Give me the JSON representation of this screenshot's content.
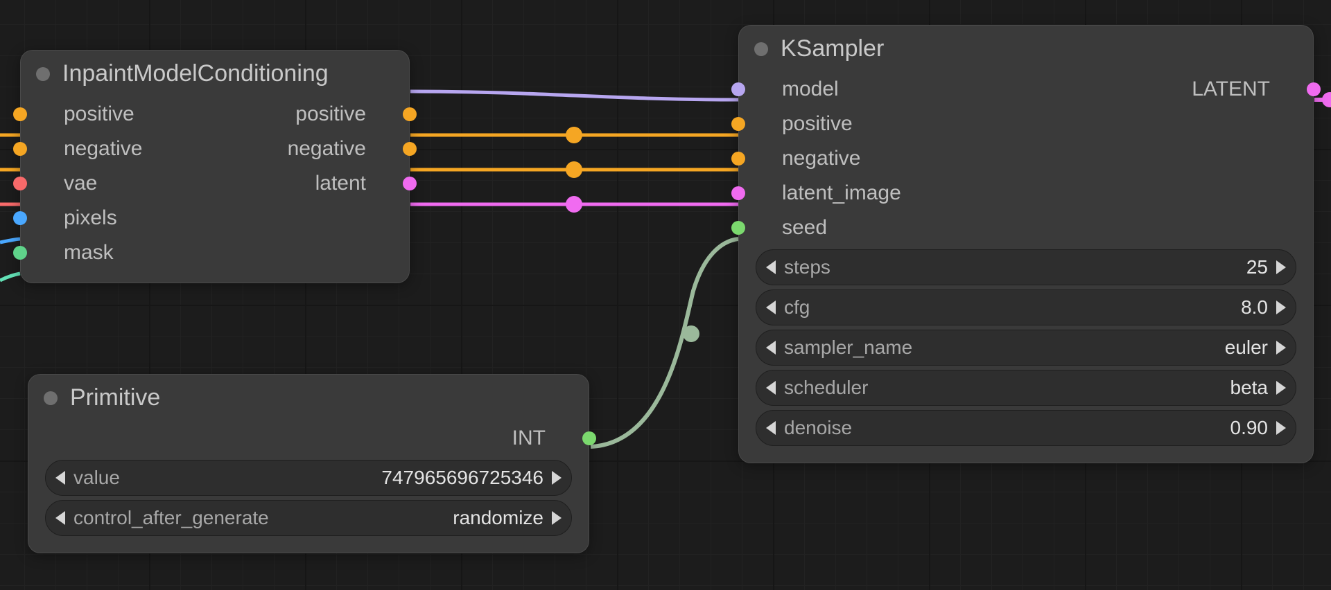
{
  "colors": {
    "orange": "#f5a623",
    "pinkred": "#f86a6a",
    "blue": "#4aa8ff",
    "green": "#5fd38a",
    "magenta": "#f06bf0",
    "lavender": "#b7a6f0",
    "lime": "#7bd96e",
    "teal": "#63e2b7"
  },
  "nodes": {
    "inpaint": {
      "title": "InpaintModelConditioning",
      "inputs": {
        "positive": "positive",
        "negative": "negative",
        "vae": "vae",
        "pixels": "pixels",
        "mask": "mask"
      },
      "outputs": {
        "positive": "positive",
        "negative": "negative",
        "latent": "latent"
      }
    },
    "primitive": {
      "title": "Primitive",
      "outputs": {
        "int": "INT"
      },
      "widgets": {
        "value": {
          "label": "value",
          "value": "747965696725346"
        },
        "control_after_generate": {
          "label": "control_after_generate",
          "value": "randomize"
        }
      }
    },
    "ksampler": {
      "title": "KSampler",
      "inputs": {
        "model": "model",
        "positive": "positive",
        "negative": "negative",
        "latent_image": "latent_image",
        "seed": "seed"
      },
      "outputs": {
        "latent": "LATENT"
      },
      "widgets": {
        "steps": {
          "label": "steps",
          "value": "25"
        },
        "cfg": {
          "label": "cfg",
          "value": "8.0"
        },
        "sampler_name": {
          "label": "sampler_name",
          "value": "euler"
        },
        "scheduler": {
          "label": "scheduler",
          "value": "beta"
        },
        "denoise": {
          "label": "denoise",
          "value": "0.90"
        }
      }
    }
  }
}
